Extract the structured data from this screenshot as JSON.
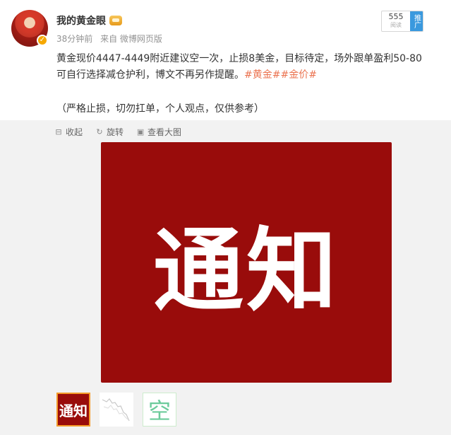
{
  "post": {
    "username": "我的黄金眼",
    "time": "38分钟前",
    "source": "来自 微博网页版",
    "read_count": "555",
    "read_label": "阅读",
    "promote_label": "推广",
    "text": "黄金现价4447-4449附近建议空一次，止损8美金，目标待定，场外跟单盈利50-80可自行选择减仓护利，博文不再另作提醒。",
    "hashtags": [
      "#黄金#",
      "#金价#"
    ],
    "note": "（严格止损，切勿扛单，个人观点，仅供参考）"
  },
  "toolbar": {
    "collapse": "收起",
    "rotate": "旋转",
    "view_large": "查看大图"
  },
  "image": {
    "main_text": "通知",
    "thumb_text_1": "通知",
    "thumb_text_3": "空"
  },
  "colors": {
    "image_red": "#990c0b",
    "hashtag": "#eb7350",
    "promote_blue": "#3a99de"
  }
}
